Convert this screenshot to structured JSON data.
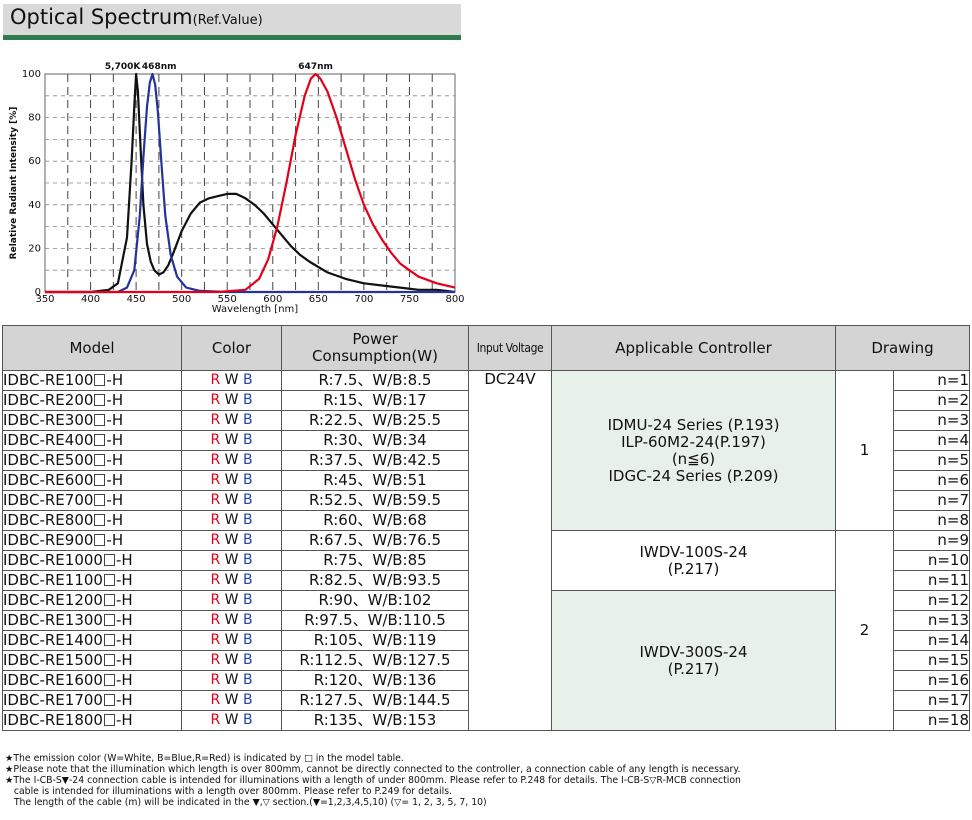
{
  "header": {
    "title": "Optical Spectrum",
    "subtitle": "(Ref.Value)"
  },
  "chart_data": {
    "type": "line",
    "xlabel": "Wavelength [nm]",
    "ylabel": "Relative Radiant Intensity [%]",
    "xlim": [
      350,
      800
    ],
    "ylim": [
      0,
      100
    ],
    "xticks": [
      "350",
      "400",
      "450",
      "500",
      "550",
      "600",
      "650",
      "700",
      "750",
      "800"
    ],
    "yticks": [
      "0",
      "20",
      "40",
      "60",
      "80",
      "100"
    ],
    "annotations": [
      "5,700K",
      "468nm",
      "647nm"
    ],
    "series": [
      {
        "color": "#111111",
        "x": [
          350,
          400,
          420,
          430,
          440,
          445,
          448,
          450,
          452,
          455,
          458,
          462,
          466,
          470,
          475,
          480,
          485,
          490,
          500,
          510,
          520,
          530,
          540,
          550,
          560,
          570,
          580,
          590,
          600,
          610,
          620,
          630,
          640,
          660,
          680,
          700,
          720,
          740,
          760,
          780,
          800
        ],
        "y": [
          0,
          0,
          1,
          4,
          25,
          60,
          85,
          100,
          92,
          65,
          40,
          22,
          14,
          10,
          8,
          9,
          12,
          17,
          28,
          36,
          41,
          43,
          44,
          45,
          45,
          43,
          40,
          36,
          31,
          26,
          21,
          17,
          14,
          9,
          6,
          4,
          3,
          2,
          1,
          1,
          0
        ]
      },
      {
        "color": "#223399",
        "x": [
          350,
          430,
          440,
          448,
          454,
          458,
          462,
          465,
          468,
          471,
          474,
          478,
          482,
          488,
          495,
          505,
          520,
          550,
          800
        ],
        "y": [
          0,
          0,
          2,
          10,
          35,
          62,
          85,
          96,
          100,
          95,
          82,
          58,
          35,
          17,
          7,
          2,
          0.5,
          0,
          0
        ]
      },
      {
        "color": "#e3001b",
        "x": [
          350,
          540,
          570,
          585,
          595,
          605,
          615,
          625,
          635,
          642,
          647,
          652,
          660,
          670,
          680,
          690,
          700,
          710,
          720,
          730,
          740,
          750,
          760,
          780,
          800
        ],
        "y": [
          0,
          0,
          1,
          6,
          15,
          30,
          50,
          72,
          90,
          98,
          100,
          98,
          92,
          80,
          66,
          52,
          40,
          31,
          24,
          18,
          13,
          10,
          7,
          4,
          2
        ]
      }
    ]
  },
  "table": {
    "headers": [
      "Model",
      "Color",
      "Power Consumption(W)",
      "Input Voltage",
      "Applicable Controller",
      "Drawing"
    ],
    "power_line1": "Power",
    "power_line2": "Consumption(W)",
    "voltage": "DC24V",
    "color_letters": [
      "R",
      "W",
      "B"
    ],
    "rows": [
      {
        "pre": "IDBC-RE100",
        "suf": "-H",
        "power": "R:7.5、W/B:8.5",
        "n": "n=1"
      },
      {
        "pre": "IDBC-RE200",
        "suf": "-H",
        "power": "R:15、W/B:17",
        "n": "n=2"
      },
      {
        "pre": "IDBC-RE300",
        "suf": "-H",
        "power": "R:22.5、W/B:25.5",
        "n": "n=3"
      },
      {
        "pre": "IDBC-RE400",
        "suf": "-H",
        "power": "R:30、W/B:34",
        "n": "n=4"
      },
      {
        "pre": "IDBC-RE500",
        "suf": "-H",
        "power": "R:37.5、W/B:42.5",
        "n": "n=5"
      },
      {
        "pre": "IDBC-RE600",
        "suf": "-H",
        "power": "R:45、W/B:51",
        "n": "n=6"
      },
      {
        "pre": "IDBC-RE700",
        "suf": "-H",
        "power": "R:52.5、W/B:59.5",
        "n": "n=7"
      },
      {
        "pre": "IDBC-RE800",
        "suf": "-H",
        "power": "R:60、W/B:68",
        "n": "n=8"
      },
      {
        "pre": "IDBC-RE900",
        "suf": "-H",
        "power": "R:67.5、W/B:76.5",
        "n": "n=9"
      },
      {
        "pre": "IDBC-RE1000",
        "suf": "-H",
        "power": "R:75、W/B:85",
        "n": "n=10"
      },
      {
        "pre": "IDBC-RE1100",
        "suf": "-H",
        "power": "R:82.5、W/B:93.5",
        "n": "n=11"
      },
      {
        "pre": "IDBC-RE1200",
        "suf": "-H",
        "power": "R:90、W/B:102",
        "n": "n=12"
      },
      {
        "pre": "IDBC-RE1300",
        "suf": "-H",
        "power": "R:97.5、W/B:110.5",
        "n": "n=13"
      },
      {
        "pre": "IDBC-RE1400",
        "suf": "-H",
        "power": "R:105、W/B:119",
        "n": "n=14"
      },
      {
        "pre": "IDBC-RE1500",
        "suf": "-H",
        "power": "R:112.5、W/B:127.5",
        "n": "n=15"
      },
      {
        "pre": "IDBC-RE1600",
        "suf": "-H",
        "power": "R:120、W/B:136",
        "n": "n=16"
      },
      {
        "pre": "IDBC-RE1700",
        "suf": "-H",
        "power": "R:127.5、W/B:144.5",
        "n": "n=17"
      },
      {
        "pre": "IDBC-RE1800",
        "suf": "-H",
        "power": "R:135、W/B:153",
        "n": "n=18"
      }
    ],
    "controllers": [
      {
        "lines": [
          "IDMU-24 Series (P.193)",
          "ILP-60M2-24(P.197)",
          "(n≦6)",
          "IDGC-24 Series (P.209)"
        ]
      },
      {
        "lines": [
          "IWDV-100S-24",
          "(P.217)"
        ]
      },
      {
        "lines": [
          "IWDV-300S-24",
          "(P.217)"
        ]
      }
    ],
    "drawings": [
      "1",
      "2"
    ]
  },
  "notes": [
    "★The emission color (W=White, B=Blue,R=Red) is indicated by □ in the model table.",
    "★Please note that the illumination which length is over 800mm, cannot be directly connected to the controller, a connection cable of any length is necessary.",
    "★The I-CB-S▼-24 connection cable is intended for illuminations with a length of under 800mm. Please refer to P.248 for details. The I-CB-S▽R-MCB connection",
    "   cable is intended for illuminations with a length over 800mm. Please refer to P.249 for details.",
    "   The length of the cable (m) will be indicated in the ▼,▽ section.(▼=1,2,3,4,5,10) (▽= 1, 2, 3, 5, 7, 10)"
  ],
  "colors": {
    "accent": "#2e7d4f",
    "controller_fill": "#e8f1e9",
    "red": "#e3001b",
    "blue": "#2244aa"
  }
}
